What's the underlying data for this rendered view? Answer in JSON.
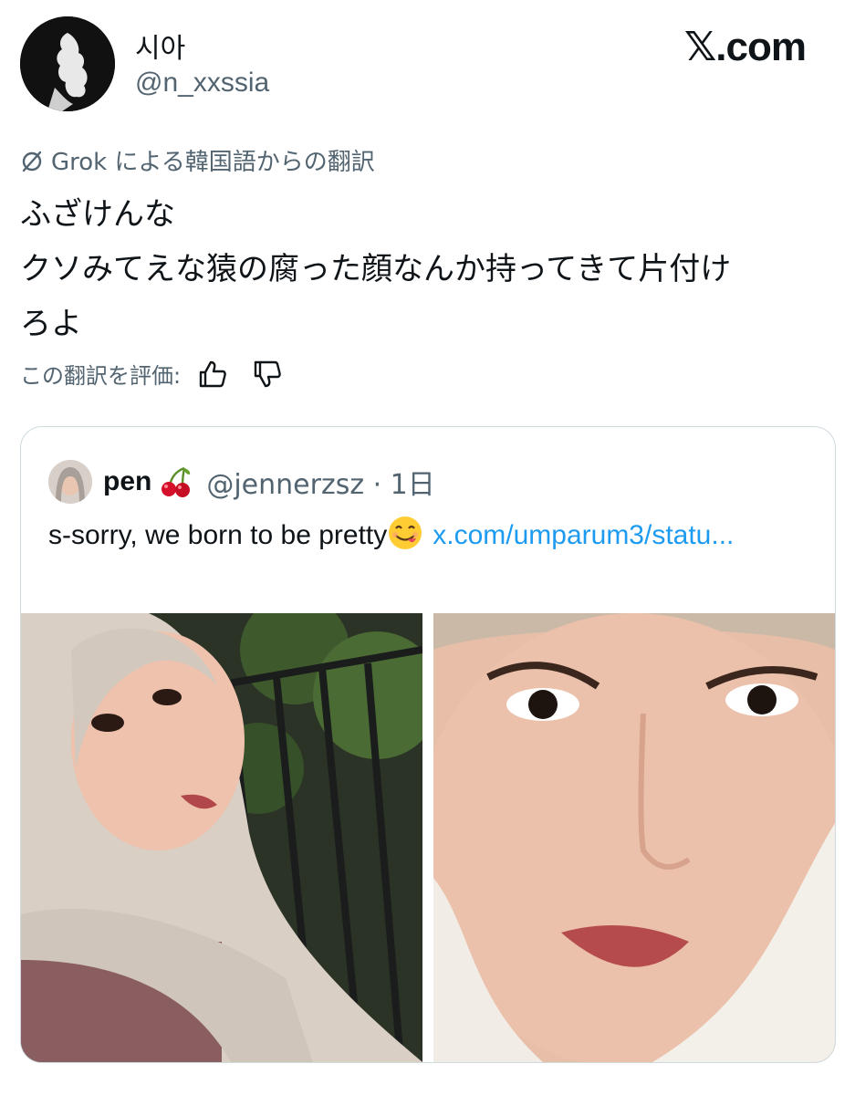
{
  "header": {
    "display_name": "시아",
    "handle": "@n_xxssia",
    "brand": "𝕏.com"
  },
  "translation": {
    "note": "Grok による韓国語からの翻訳",
    "lines": [
      "ふざけんな",
      "クソみてえな猿の腐った顔なんか持ってきて片付け",
      "ろよ"
    ],
    "rate_label": "この翻訳を評価:"
  },
  "quote": {
    "name": "pen",
    "handle_meta": "@jennerzsz · 1日",
    "text": "s-sorry, we born to be pretty",
    "link": "x.com/umparum3/statu..."
  },
  "icons": {
    "translate": "translate-slash-icon",
    "thumbs_up": "thumbs-up-icon",
    "thumbs_down": "thumbs-down-icon",
    "cherry": "cherry-emoji-icon",
    "yum": "yum-face-emoji-icon"
  },
  "colors": {
    "text_primary": "#0f1419",
    "text_secondary": "#536471",
    "link": "#1d9bf0",
    "border": "#cfd9de"
  }
}
